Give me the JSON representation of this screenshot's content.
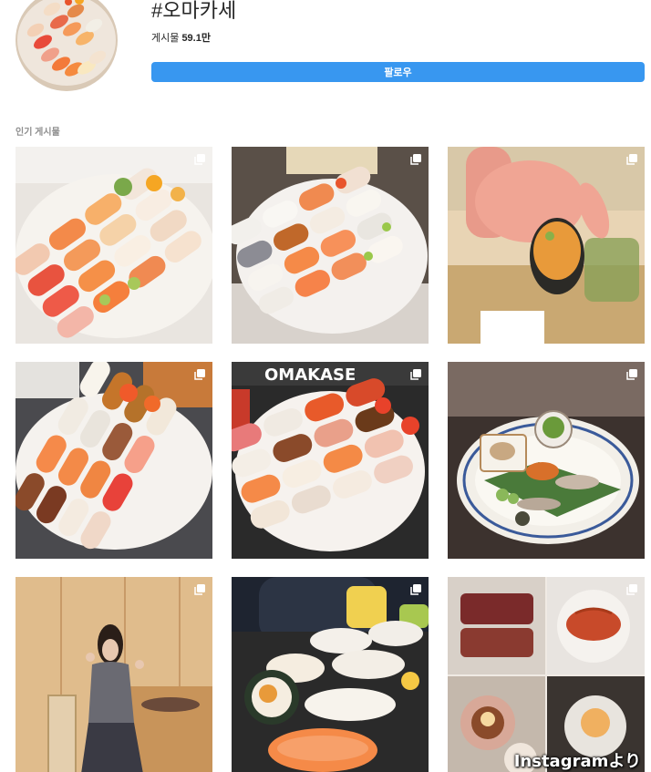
{
  "hashtag": {
    "title": "#오마카세",
    "posts_label": "게시물",
    "posts_count": "59.1만",
    "follow_label": "팔로우"
  },
  "section": {
    "popular_label": "인기 게시물"
  },
  "colors": {
    "follow_button": "#3897f0",
    "label_gray": "#8e8e8e"
  },
  "posts": [
    {
      "kind": "sushi-platter-orange",
      "multi": true
    },
    {
      "kind": "sushi-platter-mixed",
      "multi": true
    },
    {
      "kind": "hand-holding-uni",
      "multi": true
    },
    {
      "kind": "sushi-platter-eel",
      "multi": true
    },
    {
      "kind": "omakase-sign-sushi",
      "multi": true
    },
    {
      "kind": "plated-appetizers",
      "multi": true
    },
    {
      "kind": "person-in-restaurant",
      "multi": true
    },
    {
      "kind": "nigiri-closeup",
      "multi": true
    },
    {
      "kind": "beef-and-shrimp-collage",
      "multi": true
    }
  ],
  "icons": {
    "multi_post": "multi-photo-icon"
  },
  "watermark": "Instagramより"
}
